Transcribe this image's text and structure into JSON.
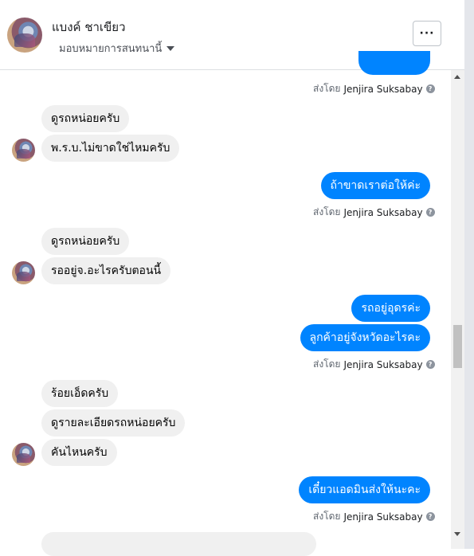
{
  "header": {
    "name": "แบงค์ ชาเขียว",
    "assign_label": "มอบหมายการสนทนานี้",
    "more_label": "···"
  },
  "sent_by": {
    "prefix": "ส่งโดย",
    "name": "Jenjira Suksabay",
    "info_glyph": "?"
  },
  "messages": {
    "m1": "ดูรถหน่อยครับ",
    "m2": "พ.ร.บ.ไม่ขาดใช่ไหมครับ",
    "m3": "ถ้าขาดเราต่อให้ค่ะ",
    "m4": "ดูรถหน่อยครับ",
    "m5": "รออยู่จ.อะไรครับตอนนี้",
    "m6": "รถอยู่อุดรค่ะ",
    "m7": "ลูกค้าอยู่จังหวัดอะไรคะ",
    "m8": "ร้อยเอ็ดครับ",
    "m9": "ดูรายละเอียดรถหน่อยครับ",
    "m10": "คันไหนครับ",
    "m11": "เดี๋ยวแอดมินส่งให้นะคะ"
  },
  "colors": {
    "outgoing_bubble": "#0084ff",
    "incoming_bubble": "#f0f0f0"
  }
}
